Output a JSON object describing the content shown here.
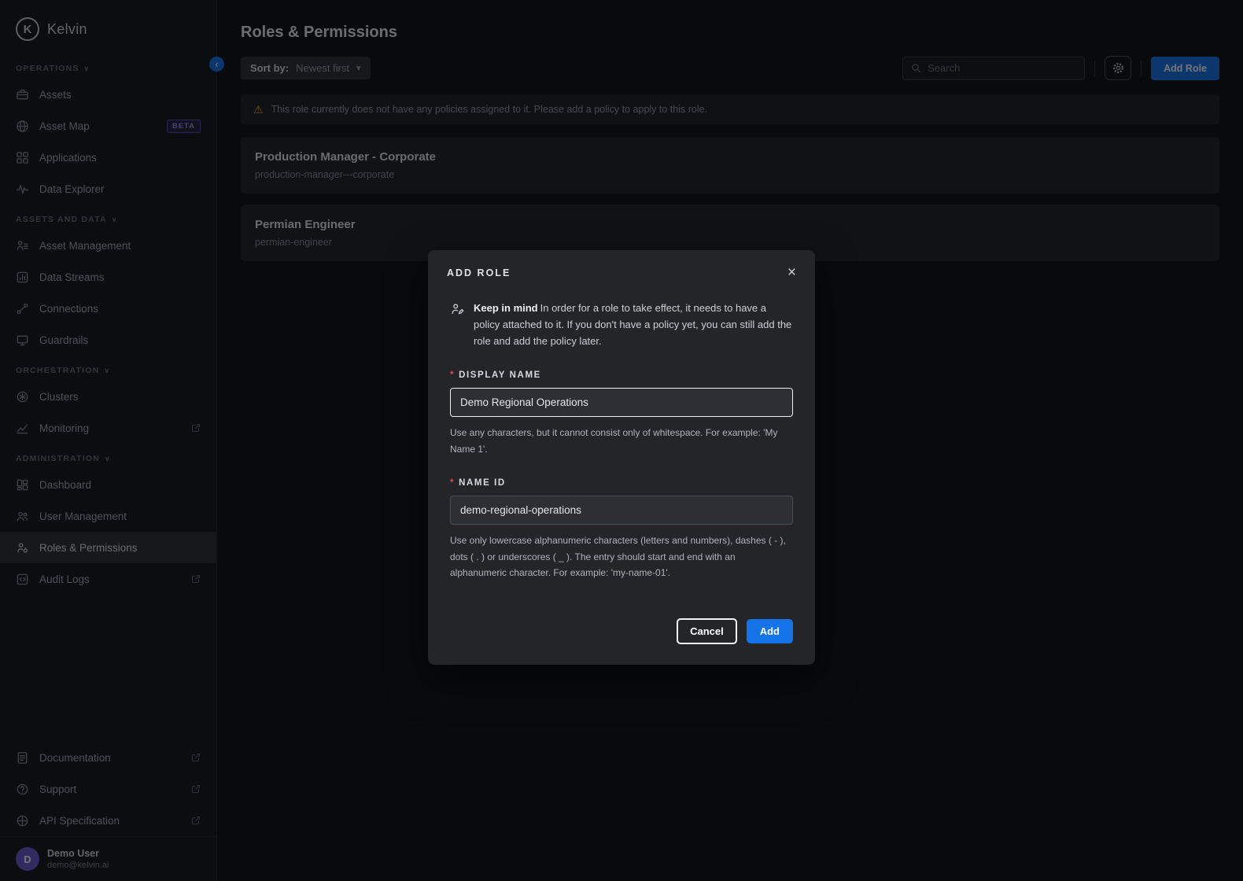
{
  "icons": {
    "chevron_down": "▾",
    "chevron_left": "‹",
    "close": "×",
    "warning": "⚠",
    "section_chevron": "∨"
  },
  "colors": {
    "accent_blue": "#1473e6",
    "beta_purple": "#6a59cf",
    "warning_yellow": "#f0a92e",
    "required_red": "#e5484d"
  },
  "brand": {
    "name": "Kelvin",
    "initial": "K"
  },
  "sidebar": {
    "sections": [
      {
        "label": "OPERATIONS",
        "items": [
          {
            "label": "Assets"
          },
          {
            "label": "Asset Map",
            "badge": "BETA"
          },
          {
            "label": "Applications"
          },
          {
            "label": "Data Explorer"
          }
        ]
      },
      {
        "label": "ASSETS AND DATA",
        "items": [
          {
            "label": "Asset Management"
          },
          {
            "label": "Data Streams"
          },
          {
            "label": "Connections"
          },
          {
            "label": "Guardrails"
          }
        ]
      },
      {
        "label": "ORCHESTRATION",
        "items": [
          {
            "label": "Clusters"
          },
          {
            "label": "Monitoring",
            "external": true
          }
        ]
      },
      {
        "label": "ADMINISTRATION",
        "items": [
          {
            "label": "Dashboard"
          },
          {
            "label": "User Management"
          },
          {
            "label": "Roles & Permissions",
            "active": true
          },
          {
            "label": "Audit Logs",
            "external": true
          }
        ]
      }
    ],
    "footer_items": [
      {
        "label": "Documentation",
        "external": true
      },
      {
        "label": "Support",
        "external": true
      },
      {
        "label": "API Specification",
        "external": true
      }
    ],
    "user": {
      "initial": "D",
      "name": "Demo User",
      "email": "demo@kelvin.ai"
    }
  },
  "main": {
    "title": "Roles & Permissions",
    "toolbar": {
      "sort_label": "Sort by:",
      "sort_value": "Newest first",
      "search_placeholder": "Search",
      "add_role_label": "Add Role"
    },
    "warning": "This role currently does not have any policies assigned to it. Please add a policy to apply to this role.",
    "roles": [
      {
        "name": "Production Manager - Corporate",
        "slug": "production-manager---corporate"
      },
      {
        "name": "Permian Engineer",
        "slug": "permian-engineer"
      }
    ]
  },
  "modal": {
    "title": "ADD ROLE",
    "note_bold": "Keep in mind",
    "note_text": "In order for a role to take effect, it needs to have a policy attached to it. If you don't have a policy yet, you can still add the role and add the policy later.",
    "required_marker": "*",
    "fields": {
      "display_name": {
        "label": "DISPLAY NAME",
        "value": "Demo Regional Operations",
        "help": "Use any characters, but it cannot consist only of whitespace. For example: 'My Name 1'."
      },
      "name_id": {
        "label": "NAME ID",
        "value": "demo-regional-operations",
        "help": "Use only lowercase alphanumeric characters (letters and numbers), dashes ( - ), dots ( . ) or underscores ( _ ). The entry should start and end with an alphanumeric character. For example: 'my-name-01'."
      }
    },
    "cancel_label": "Cancel",
    "add_label": "Add"
  }
}
